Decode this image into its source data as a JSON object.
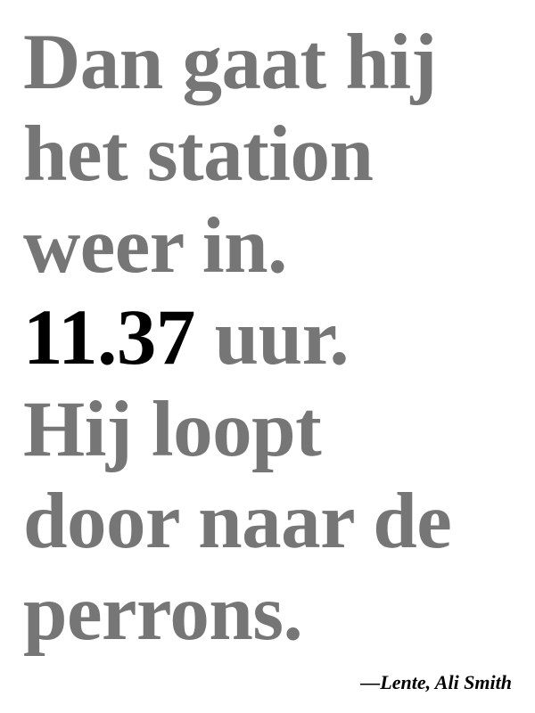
{
  "quote": {
    "lines": [
      "Dan gaat hij",
      "het station",
      "weer in."
    ],
    "time": "11.37",
    "time_suffix": " uur.",
    "lines_after": [
      "Hij loopt",
      "door naar de",
      "perrons."
    ]
  },
  "attribution": "—Lente, Ali Smith",
  "colors": {
    "text": "#767676",
    "highlight": "#000000",
    "background": "#ffffff"
  }
}
